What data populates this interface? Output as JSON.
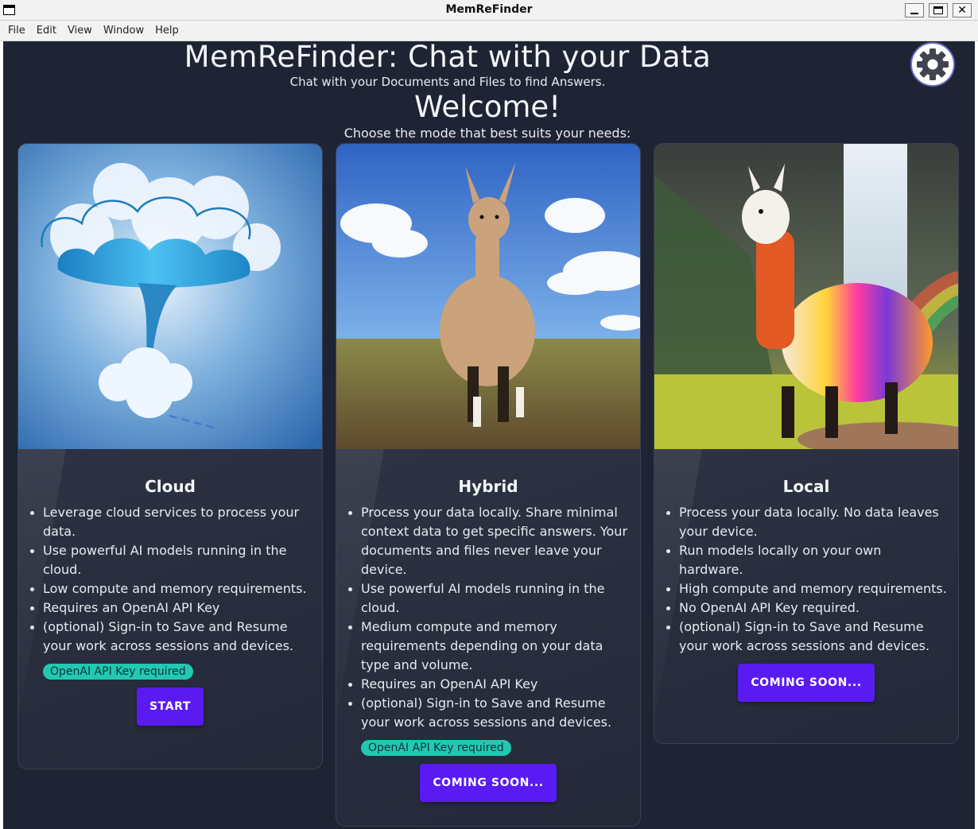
{
  "window": {
    "title": "MemReFinder",
    "controls": {
      "minimize": "_",
      "maximize": "□",
      "close": "✕"
    }
  },
  "menubar": {
    "items": [
      "File",
      "Edit",
      "View",
      "Window",
      "Help"
    ]
  },
  "header": {
    "title": "MemReFinder: Chat with your Data",
    "subtitle": "Chat with your Documents and Files to find Answers.",
    "welcome": "Welcome!",
    "prompt": "Choose the mode that best suits your needs:",
    "settings_icon": "gear-icon"
  },
  "cards": [
    {
      "title": "Cloud",
      "image": "cloud-illustration",
      "bullets": [
        "Leverage cloud services to process your data.",
        "Use powerful AI models running in the cloud.",
        "Low compute and memory requirements.",
        "Requires an OpenAI API Key",
        "(optional) Sign-in to Save and Resume your work across sessions and devices."
      ],
      "badge": "OpenAI API Key required",
      "button": "START"
    },
    {
      "title": "Hybrid",
      "image": "llama-photo",
      "bullets": [
        "Process your data locally. Share minimal context data to get specific answers. Your documents and files never leave your device.",
        "Use powerful AI models running in the cloud.",
        "Medium compute and memory requirements depending on your data type and volume.",
        "Requires an OpenAI API Key",
        "(optional) Sign-in to Save and Resume your work across sessions and devices."
      ],
      "badge": "OpenAI API Key required",
      "button": "COMING SOON..."
    },
    {
      "title": "Local",
      "image": "rainbow-llama-illustration",
      "bullets": [
        "Process your data locally. No data leaves your device.",
        "Run models locally on your own hardware.",
        "High compute and memory requirements.",
        "No OpenAI API Key required.",
        "(optional) Sign-in to Save and Resume your work across sessions and devices."
      ],
      "button": "COMING SOON..."
    }
  ],
  "colors": {
    "background": "#1e2433",
    "accent_button": "#5a1bf2",
    "badge": "#22c8b2",
    "text": "#f4f5f8"
  }
}
